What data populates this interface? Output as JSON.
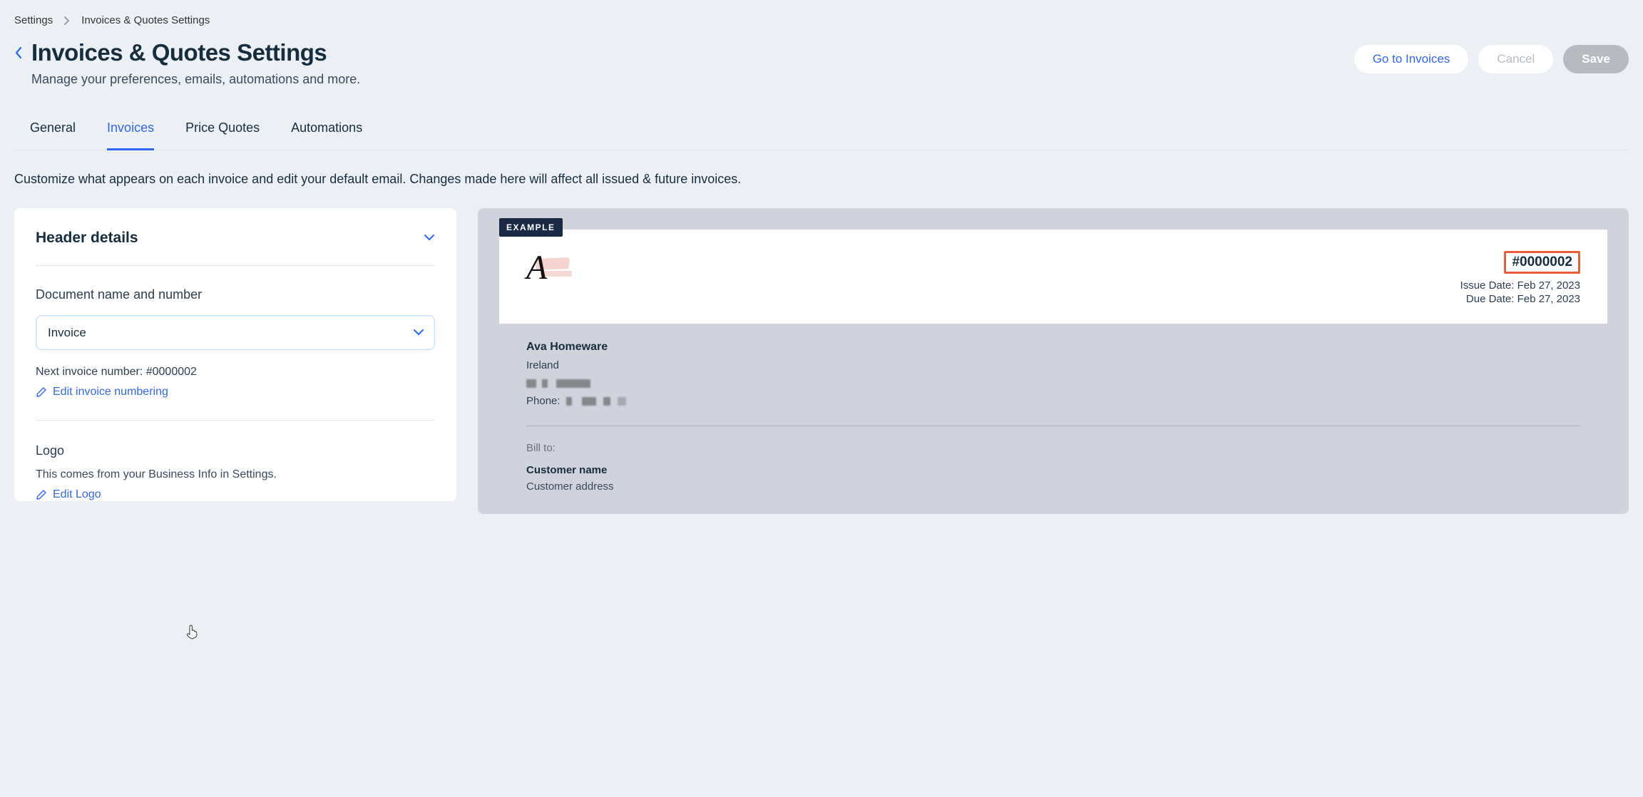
{
  "breadcrumb": {
    "root": "Settings",
    "current": "Invoices & Quotes Settings"
  },
  "header": {
    "title": "Invoices & Quotes Settings",
    "subtitle": "Manage your preferences, emails, automations and more."
  },
  "actions": {
    "go_to_invoices": "Go to Invoices",
    "cancel": "Cancel",
    "save": "Save"
  },
  "tabs": {
    "general": "General",
    "invoices": "Invoices",
    "price_quotes": "Price Quotes",
    "automations": "Automations"
  },
  "description": "Customize what appears on each invoice and edit your default email. Changes made here will affect all issued & future invoices.",
  "header_details": {
    "title": "Header details",
    "doc_name_label": "Document name and number",
    "doc_name_value": "Invoice",
    "next_number_label": "Next invoice number: #0000002",
    "edit_numbering": "Edit invoice numbering",
    "logo_title": "Logo",
    "logo_help": "This comes from your Business Info in Settings.",
    "edit_logo": "Edit Logo"
  },
  "preview": {
    "badge": "EXAMPLE",
    "logo_letter": "A",
    "invoice_number": "#0000002",
    "issue_date": "Issue Date: Feb 27, 2023",
    "due_date": "Due Date: Feb 27, 2023",
    "business_name": "Ava Homeware",
    "country": "Ireland",
    "phone_label": "Phone:",
    "bill_to": "Bill to:",
    "customer_name": "Customer name",
    "customer_address": "Customer address"
  }
}
